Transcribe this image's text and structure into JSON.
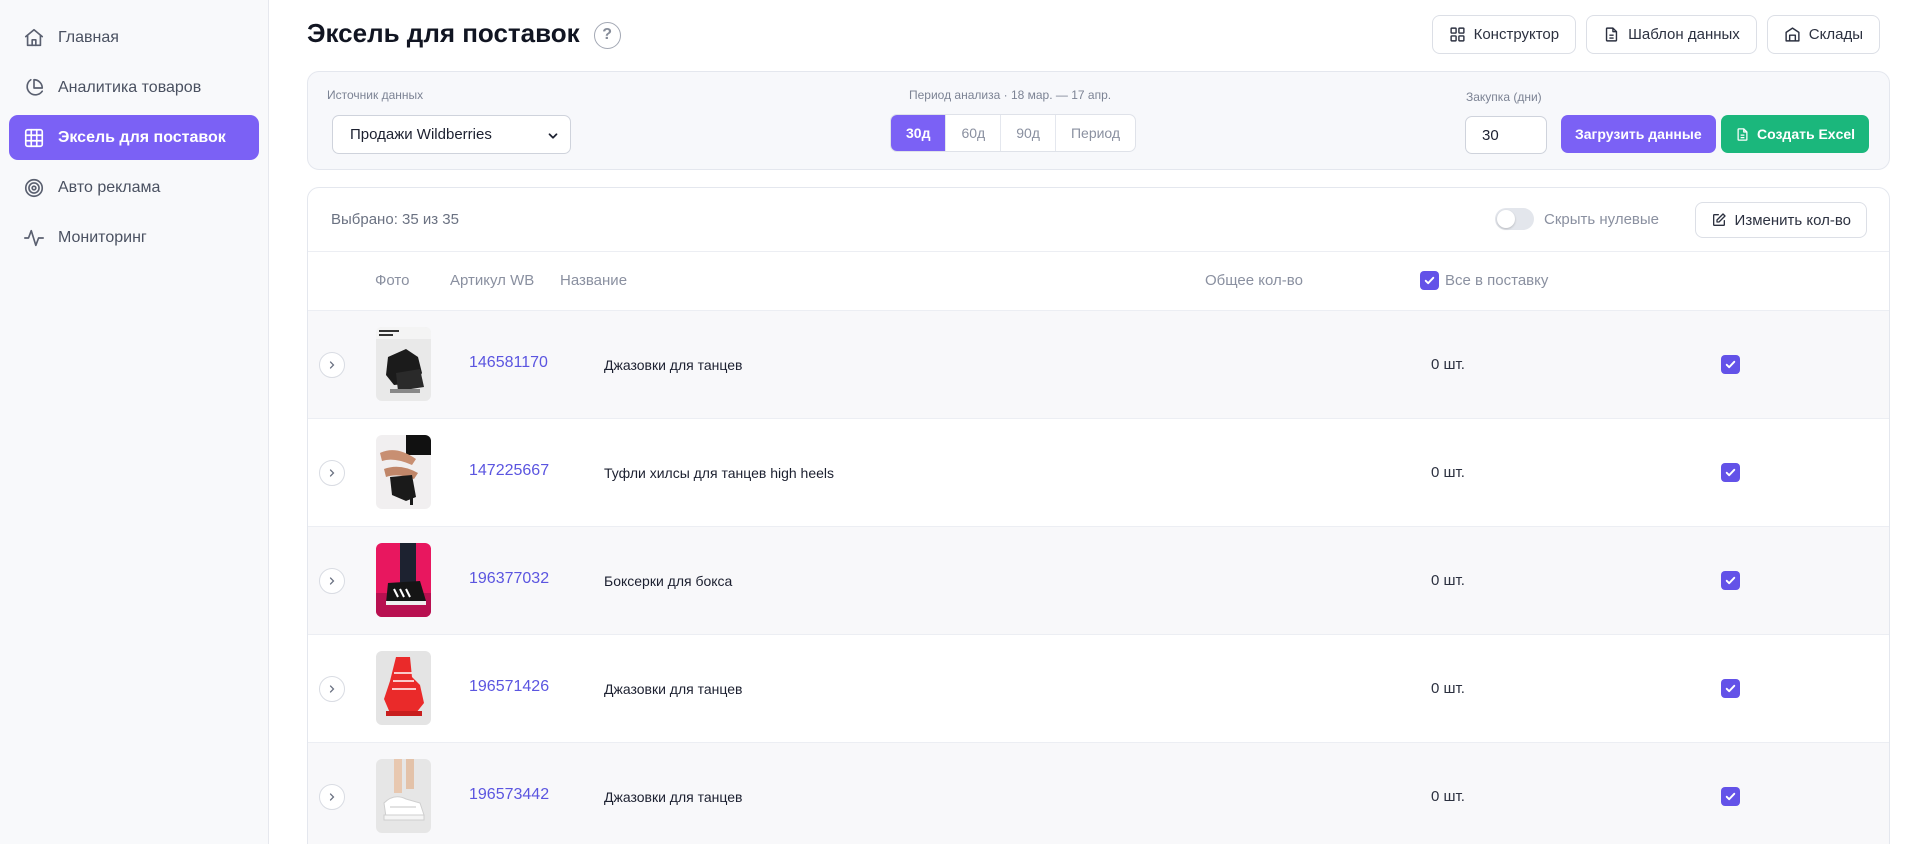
{
  "sidebar": {
    "items": [
      {
        "label": "Главная",
        "icon": "home-icon",
        "active": false
      },
      {
        "label": "Аналитика товаров",
        "icon": "pie-chart-icon",
        "active": false
      },
      {
        "label": "Эксель для поставок",
        "icon": "table-icon",
        "active": true
      },
      {
        "label": "Авто реклама",
        "icon": "target-icon",
        "active": false
      },
      {
        "label": "Мониторинг",
        "icon": "activity-icon",
        "active": false
      }
    ]
  },
  "header": {
    "title": "Эксель для поставок",
    "help": "?",
    "buttons": {
      "constructor": "Конструктор",
      "template": "Шаблон данных",
      "warehouses": "Склады"
    }
  },
  "filters": {
    "source_label": "Источник данных",
    "source_value": "Продажи Wildberries",
    "period_label": "Период анализа · 18 мар. — 17 апр.",
    "periods": [
      "30д",
      "60д",
      "90д",
      "Период"
    ],
    "active_period": "30д",
    "purchase_label": "Закупка (дни)",
    "purchase_value": "30",
    "load_button": "Загрузить данные",
    "excel_button": "Создать Excel"
  },
  "table": {
    "selected_text": "Выбрано: 35 из 35",
    "hide_zero_label": "Скрыть нулевые",
    "hide_zero_on": false,
    "change_qty_button": "Изменить кол-во",
    "columns": {
      "photo": "Фото",
      "sku": "Артикул WB",
      "name": "Название",
      "qty": "Общее кол-во",
      "all": "Все в поставку"
    },
    "rows": [
      {
        "sku": "146581170",
        "name": "Джазовки для танцев",
        "qty": "0 шт.",
        "checked": true
      },
      {
        "sku": "147225667",
        "name": "Туфли хилсы для танцев high heels",
        "qty": "0 шт.",
        "checked": true
      },
      {
        "sku": "196377032",
        "name": "Боксерки для бокса",
        "qty": "0 шт.",
        "checked": true
      },
      {
        "sku": "196571426",
        "name": "Джазовки для танцев",
        "qty": "0 шт.",
        "checked": true
      },
      {
        "sku": "196573442",
        "name": "Джазовки для танцев",
        "qty": "0 шт.",
        "checked": true
      }
    ]
  },
  "colors": {
    "accent": "#7b61f5",
    "excel_green": "#1bb77c",
    "link": "#5b55e0"
  }
}
